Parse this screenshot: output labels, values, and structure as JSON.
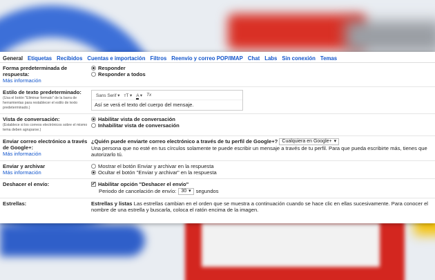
{
  "tabs": [
    {
      "label": "General",
      "active": true
    },
    {
      "label": "Etiquetas"
    },
    {
      "label": "Recibidos"
    },
    {
      "label": "Cuentas e importación"
    },
    {
      "label": "Filtros"
    },
    {
      "label": "Reenvío y correo POP/IMAP"
    },
    {
      "label": "Chat"
    },
    {
      "label": "Labs"
    },
    {
      "label": "Sin conexión"
    },
    {
      "label": "Temas"
    }
  ],
  "reply": {
    "label": "Forma predeterminada de respuesta:",
    "more": "Más información",
    "options": [
      "Responder",
      "Responder a todos"
    ],
    "selected": 0
  },
  "text_style": {
    "label": "Estilo de texto predeterminado:",
    "hint": "(Usa el botón \"Eliminar formato\" de la barra de herramientas para restablecer el estilo de texto predeterminado.)",
    "font": "Sans Serif",
    "font_arrow": "▾",
    "size_glyph": "ᴛT",
    "size_arrow": "▾",
    "color_glyph": "A",
    "color_arrow": "▾",
    "clear_glyph": "Tx",
    "sample": "Así se verá el texto del cuerpo del mensaje."
  },
  "conversation": {
    "label": "Vista de conversación:",
    "hint": "(Establece si los correos electrónicos sobre el mismo tema deben agruparse.)",
    "options": [
      "Habilitar vista de conversación",
      "Inhabilitar vista de conversación"
    ],
    "selected": 0
  },
  "google_plus": {
    "label": "Enviar correo electrónico a través de Google+:",
    "more": "Más información",
    "question": "¿Quién puede enviarte correo electrónico a través de tu perfil de Google+?",
    "select_value": "Cualquiera en Google+",
    "select_arrow": "▾",
    "description": "Una persona que no esté en tus círculos solamente te puede escribir un mensaje a través de tu perfil. Para que pueda escribirte más, tienes que autorizarlo tú."
  },
  "send_archive": {
    "label": "Enviar y archivar",
    "more": "Más información",
    "options": [
      "Mostrar el botón Enviar y archivar en la respuesta",
      "Ocultar el botón \"Enviar y archivar\" en la respuesta"
    ],
    "selected": 1
  },
  "undo_send": {
    "label": "Deshacer el envío:",
    "option": "Habilitar opción \"Deshacer el envío\"",
    "checked": true,
    "check_glyph": "✔",
    "period_label": "Periodo de cancelación de envío:",
    "period_value": "30",
    "period_arrow": "▾",
    "period_unit": "segundos"
  },
  "stars": {
    "label": "Estrellas:",
    "title": "Estrellas y listas",
    "text": "Las estrellas cambian en el orden que se muestra a continuación cuando se hace clic en ellas sucesivamente. Para conocer el nombre de una estrella y buscarla, coloca el ratón encima de la imagen."
  }
}
